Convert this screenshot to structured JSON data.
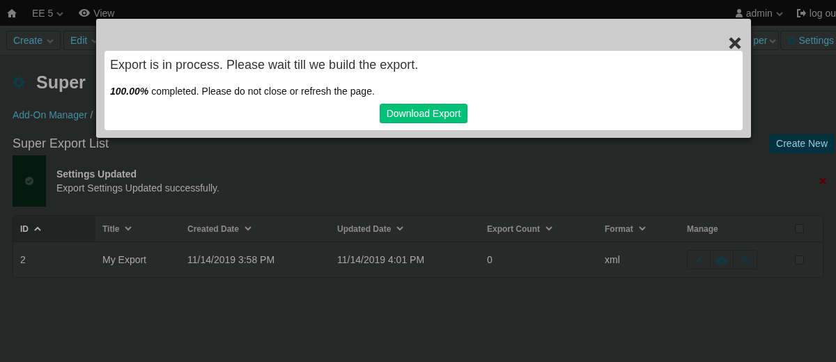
{
  "top_bar": {
    "site": "EE 5",
    "view": "View",
    "user": "admin",
    "logout": "log ou"
  },
  "toolbar": {
    "left": [
      "Create",
      "Edit"
    ],
    "right": [
      {
        "label": "per",
        "kind": "menu"
      },
      {
        "label": "Settings",
        "kind": "settings"
      }
    ]
  },
  "page": {
    "title": "Super",
    "breadcrumb": "Add-On Manager",
    "breadcrumb_separator": "/",
    "heading": "Super Export List",
    "create_button": "Create New"
  },
  "alert": {
    "title": "Settings Updated",
    "message": "Export Settings Updated successfully."
  },
  "table": {
    "columns": [
      {
        "label": "ID",
        "sortable": true,
        "selected": true
      },
      {
        "label": "Title",
        "sortable": true,
        "selected": false
      },
      {
        "label": "Created Date",
        "sortable": true,
        "selected": false
      },
      {
        "label": "Updated Date",
        "sortable": true,
        "selected": false
      },
      {
        "label": "Export Count",
        "sortable": true,
        "selected": false
      },
      {
        "label": "Format",
        "sortable": true,
        "selected": false
      },
      {
        "label": "Manage",
        "sortable": false,
        "selected": false
      }
    ],
    "all_checked": false,
    "rows": [
      {
        "cells": [
          "2",
          "My Export",
          "11/14/2019 3:58 PM",
          "11/14/2019 4:01 PM",
          "0",
          "xml"
        ],
        "checked": false
      }
    ]
  },
  "modal": {
    "message": "Export is in process. Please wait till we build the export.",
    "progress": "**100.00%** completed. Please do not close or refresh the page.",
    "button": "Download Export"
  }
}
